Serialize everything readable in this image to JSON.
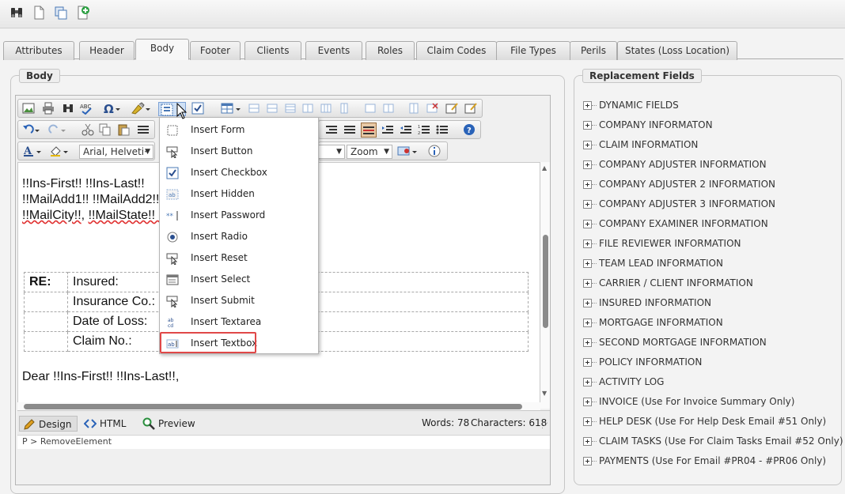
{
  "tabs": [
    {
      "label": "Attributes"
    },
    {
      "label": "Header"
    },
    {
      "label": "Body"
    },
    {
      "label": "Footer"
    },
    {
      "label": "Clients"
    },
    {
      "label": "Events"
    },
    {
      "label": "Roles"
    },
    {
      "label": "Claim Codes"
    },
    {
      "label": "File Types"
    },
    {
      "label": "Perils"
    },
    {
      "label": "States (Loss Location)"
    }
  ],
  "body_panel": {
    "legend": "Body"
  },
  "editor": {
    "font_select": "Arial, Helveti·",
    "zoom_select": "Zoom",
    "content": {
      "line1": "!!Ins-First!! !!Ins-Last!!",
      "line2": "!!MailAdd1!! !!MailAdd2!!",
      "line3_city": "!!MailCity!!",
      "line3_sep": ", ",
      "line3_state": "!!MailState!! !",
      "re_label": "RE:",
      "rows": [
        "Insured:",
        "Insurance Co.:",
        "Date of Loss:",
        "Claim No.:"
      ],
      "greeting": "Dear !!Ins-First!! !!Ins-Last!!,"
    },
    "modes": {
      "design": "Design",
      "html": "HTML",
      "preview": "Preview"
    },
    "words": "Words: 78",
    "characters": "Characters: 618",
    "path": "P > RemoveElement"
  },
  "form_menu": {
    "items": [
      {
        "label": "Insert Form",
        "icon": "form-icon"
      },
      {
        "label": "Insert Button",
        "icon": "button-cursor-icon"
      },
      {
        "label": "Insert Checkbox",
        "icon": "checkbox-icon"
      },
      {
        "label": "Insert Hidden",
        "icon": "hidden-field-icon"
      },
      {
        "label": "Insert Password",
        "icon": "password-icon"
      },
      {
        "label": "Insert Radio",
        "icon": "radio-icon"
      },
      {
        "label": "Insert Reset",
        "icon": "reset-cursor-icon"
      },
      {
        "label": "Insert Select",
        "icon": "select-icon"
      },
      {
        "label": "Insert Submit",
        "icon": "submit-cursor-icon"
      },
      {
        "label": "Insert Textarea",
        "icon": "textarea-icon"
      },
      {
        "label": "Insert Textbox",
        "icon": "textbox-icon"
      }
    ],
    "highlight_color": "#e04848"
  },
  "replacement": {
    "legend": "Replacement Fields",
    "items": [
      "DYNAMIC FIELDS",
      "COMPANY INFORMATON",
      "CLAIM INFORMATION",
      "COMPANY ADJUSTER INFORMATION",
      "COMPANY ADJUSTER 2 INFORMATION",
      "COMPANY ADJUSTER 3 INFORMATION",
      "COMPANY EXAMINER INFORMATION",
      "FILE REVIEWER INFORMATION",
      "TEAM LEAD INFORMATION",
      "CARRIER / CLIENT INFORMATION",
      "INSURED INFORMATION",
      "MORTGAGE INFORMATION",
      "SECOND MORTGAGE INFORMATION",
      "POLICY INFORMATION",
      "ACTIVITY LOG",
      "INVOICE (Use For Invoice Summary Only)",
      "HELP DESK (Use For Help Desk Email #51 Only)",
      "CLAIM TASKS (Use For Claim Tasks Email #52 Only)",
      "PAYMENTS (Use For Email #PR04 - #PR06 Only)"
    ]
  }
}
